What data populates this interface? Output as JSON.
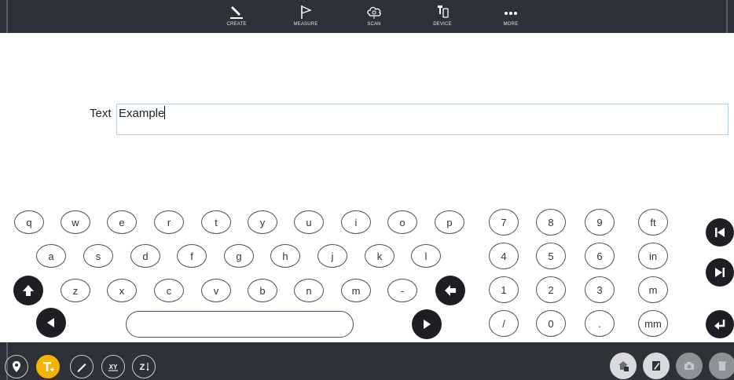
{
  "toolbar": {
    "items": [
      {
        "label": "CREATE",
        "icon": "pencil-icon"
      },
      {
        "label": "MEASURE",
        "icon": "flag-icon"
      },
      {
        "label": "SCAN",
        "icon": "cloud-scan-icon"
      },
      {
        "label": "DEVICE",
        "icon": "device-icon"
      },
      {
        "label": "MORE",
        "icon": "more-dots-icon"
      }
    ]
  },
  "field": {
    "label": "Text",
    "value": "Example"
  },
  "keyboard": {
    "row1": [
      "q",
      "w",
      "e",
      "r",
      "t",
      "y",
      "u",
      "i",
      "o",
      "p"
    ],
    "row2": [
      "a",
      "s",
      "d",
      "f",
      "g",
      "h",
      "j",
      "k",
      "l"
    ],
    "row3": [
      "z",
      "x",
      "c",
      "v",
      "b",
      "n",
      "m",
      "-"
    ],
    "numpad": [
      [
        "7",
        "8",
        "9",
        "ft"
      ],
      [
        "4",
        "5",
        "6",
        "in"
      ],
      [
        "1",
        "2",
        "3",
        "m"
      ],
      [
        "/",
        "0",
        ".",
        "mm"
      ]
    ]
  },
  "bottombar": {
    "left_buttons": [
      {
        "name": "location-pin-icon"
      },
      {
        "name": "text-add-icon",
        "active": true
      },
      {
        "name": "pencil-line-icon"
      },
      {
        "name": "xy-icon",
        "text": "XY"
      },
      {
        "name": "z-elevation-icon",
        "text": "Z"
      }
    ],
    "right_buttons": [
      {
        "name": "home-save-icon"
      },
      {
        "name": "edit-layer-icon"
      },
      {
        "name": "camera-icon"
      },
      {
        "name": "trash-icon"
      }
    ]
  },
  "colors": {
    "bar": "#2e3138",
    "accent": "#f5b400",
    "key_border": "#4b5160",
    "input_border": "#b9cde0"
  }
}
